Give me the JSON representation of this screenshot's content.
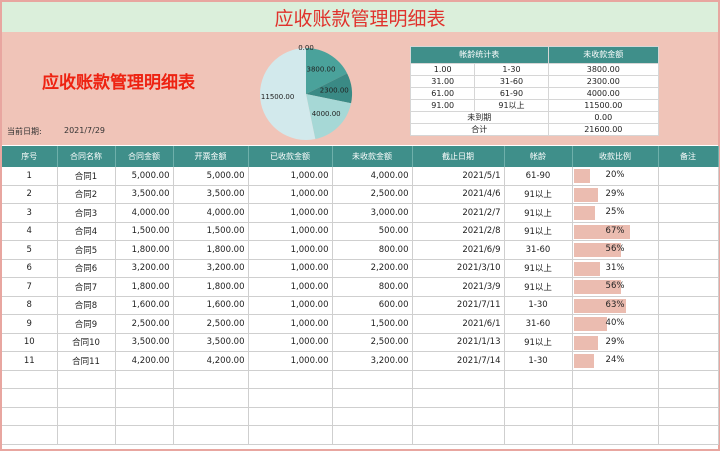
{
  "title": "应收账款管理明细表",
  "summary_title": "应收账款管理明细表",
  "date_label": "当前日期:",
  "date_value": "2021/7/29",
  "aging_table": {
    "header": [
      "帐龄统计表",
      "未收款金额"
    ],
    "rows": [
      {
        "from": "1.00",
        "to": "1-30",
        "amount": "3800.00"
      },
      {
        "from": "31.00",
        "to": "31-60",
        "amount": "2300.00"
      },
      {
        "from": "61.00",
        "to": "61-90",
        "amount": "4000.00"
      },
      {
        "from": "91.00",
        "to": "91以上",
        "amount": "11500.00"
      }
    ],
    "not_due_label": "未到期",
    "not_due_amount": "0.00",
    "total_label": "合计",
    "total_amount": "21600.00"
  },
  "chart_data": {
    "type": "pie",
    "labels": [
      "0.00",
      "3800.00",
      "2300.00",
      "4000.00",
      "11500.00"
    ],
    "values": [
      0,
      3800,
      2300,
      4000,
      11500
    ],
    "colors": [
      "#2e8c86",
      "#4aa29b",
      "#3a8a85",
      "#a6d8d6",
      "#d2e9ec"
    ]
  },
  "columns": [
    "序号",
    "合同名称",
    "合同金额",
    "开票金额",
    "已收款金额",
    "未收款金额",
    "截止日期",
    "帐龄",
    "收款比例",
    "备注"
  ],
  "rows": [
    {
      "no": "1",
      "name": "合同1",
      "contract": "5,000.00",
      "invoice": "5,000.00",
      "received": "1,000.00",
      "unpaid": "4,000.00",
      "due": "2021/5/1",
      "age": "61-90",
      "ratio": 0.2,
      "ratio_text": "20%"
    },
    {
      "no": "2",
      "name": "合同2",
      "contract": "3,500.00",
      "invoice": "3,500.00",
      "received": "1,000.00",
      "unpaid": "2,500.00",
      "due": "2021/4/6",
      "age": "91以上",
      "ratio": 0.29,
      "ratio_text": "29%"
    },
    {
      "no": "3",
      "name": "合同3",
      "contract": "4,000.00",
      "invoice": "4,000.00",
      "received": "1,000.00",
      "unpaid": "3,000.00",
      "due": "2021/2/7",
      "age": "91以上",
      "ratio": 0.25,
      "ratio_text": "25%"
    },
    {
      "no": "4",
      "name": "合同4",
      "contract": "1,500.00",
      "invoice": "1,500.00",
      "received": "1,000.00",
      "unpaid": "500.00",
      "due": "2021/2/8",
      "age": "91以上",
      "ratio": 0.67,
      "ratio_text": "67%"
    },
    {
      "no": "5",
      "name": "合同5",
      "contract": "1,800.00",
      "invoice": "1,800.00",
      "received": "1,000.00",
      "unpaid": "800.00",
      "due": "2021/6/9",
      "age": "31-60",
      "ratio": 0.56,
      "ratio_text": "56%"
    },
    {
      "no": "6",
      "name": "合同6",
      "contract": "3,200.00",
      "invoice": "3,200.00",
      "received": "1,000.00",
      "unpaid": "2,200.00",
      "due": "2021/3/10",
      "age": "91以上",
      "ratio": 0.31,
      "ratio_text": "31%"
    },
    {
      "no": "7",
      "name": "合同7",
      "contract": "1,800.00",
      "invoice": "1,800.00",
      "received": "1,000.00",
      "unpaid": "800.00",
      "due": "2021/3/9",
      "age": "91以上",
      "ratio": 0.56,
      "ratio_text": "56%"
    },
    {
      "no": "8",
      "name": "合同8",
      "contract": "1,600.00",
      "invoice": "1,600.00",
      "received": "1,000.00",
      "unpaid": "600.00",
      "due": "2021/7/11",
      "age": "1-30",
      "ratio": 0.63,
      "ratio_text": "63%"
    },
    {
      "no": "9",
      "name": "合同9",
      "contract": "2,500.00",
      "invoice": "2,500.00",
      "received": "1,000.00",
      "unpaid": "1,500.00",
      "due": "2021/6/1",
      "age": "31-60",
      "ratio": 0.4,
      "ratio_text": "40%"
    },
    {
      "no": "10",
      "name": "合同10",
      "contract": "3,500.00",
      "invoice": "3,500.00",
      "received": "1,000.00",
      "unpaid": "2,500.00",
      "due": "2021/1/13",
      "age": "91以上",
      "ratio": 0.29,
      "ratio_text": "29%"
    },
    {
      "no": "11",
      "name": "合同11",
      "contract": "4,200.00",
      "invoice": "4,200.00",
      "received": "1,000.00",
      "unpaid": "3,200.00",
      "due": "2021/7/14",
      "age": "1-30",
      "ratio": 0.24,
      "ratio_text": "24%"
    }
  ]
}
